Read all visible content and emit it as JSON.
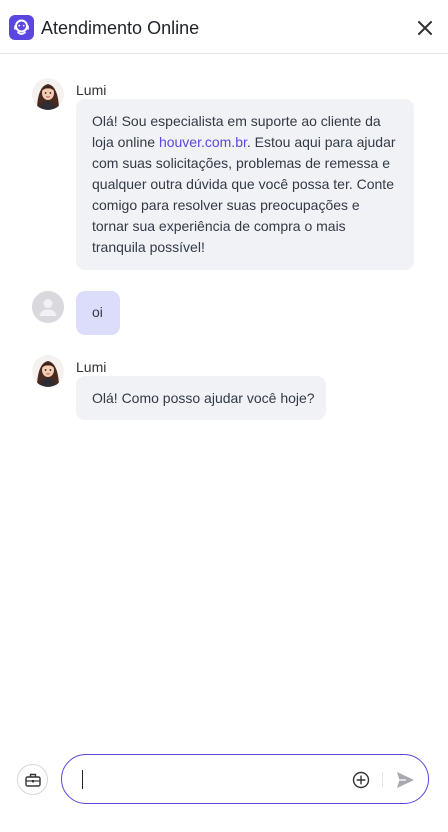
{
  "header": {
    "title": "Atendimento Online",
    "brand_icon": "chat-bot-icon",
    "close_icon": "close-icon",
    "accent_color": "#5b47e0"
  },
  "messages": [
    {
      "role": "bot",
      "sender": "Lumi",
      "text_before": "Olá! Sou especialista em suporte ao cliente da loja online ",
      "link_text": "houver.com.br",
      "text_after": ". Estou aqui para ajudar com suas solicitações, problemas de remessa e qualquer outra dúvida que você possa ter. Conte comigo para resolver suas preocupações e tornar sua experiência de compra o mais tranquila possível!"
    },
    {
      "role": "user",
      "text": "oi"
    },
    {
      "role": "bot",
      "sender": "Lumi",
      "text": "Olá! Como posso ajudar você hoje?"
    }
  ],
  "composer": {
    "value": "",
    "tools_icon": "toolbox-icon",
    "attach_icon": "plus-circle-icon",
    "send_icon": "send-icon"
  }
}
